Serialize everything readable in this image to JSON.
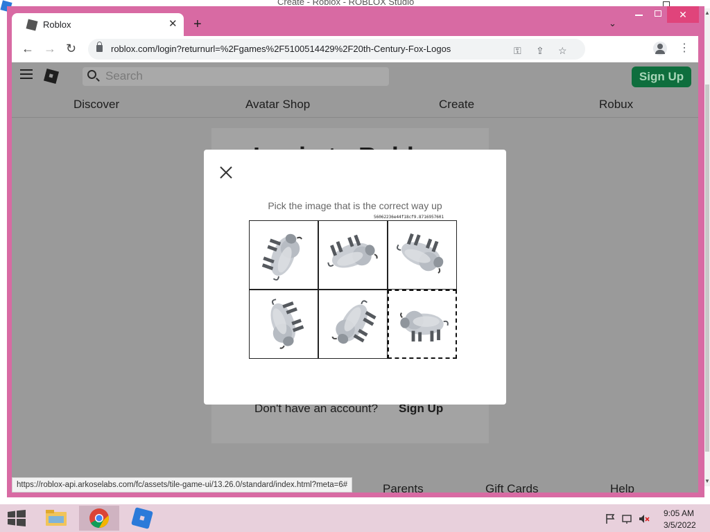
{
  "background_window": {
    "title": "Create - Roblox - ROBLOX Studio"
  },
  "browser": {
    "tab": {
      "title": "Roblox"
    },
    "address_bar": {
      "url": "roblox.com/login?returnurl=%2Fgames%2F5100514429%2F20th-Century-Fox-Logos"
    },
    "status_url": "https://roblox-api.arkoselabs.com/fc/assets/tile-game-ui/13.26.0/standard/index.html?meta=6#"
  },
  "roblox": {
    "search": {
      "placeholder": "Search"
    },
    "signup_button": "Sign Up",
    "nav": [
      "Discover",
      "Avatar Shop",
      "Create",
      "Robux"
    ],
    "login_heading": "Login to Roblox",
    "no_account_text": "Don't have an account?",
    "no_account_signup": "Sign Up",
    "footer_links": [
      "Parents",
      "Gift Cards",
      "Help"
    ]
  },
  "captcha": {
    "prompt": "Pick the image that is the correct way up",
    "session_hash": "56062236e44f18cf9.8716957601",
    "tiles": [
      {
        "rotation": 110,
        "selected": false
      },
      {
        "rotation": 160,
        "selected": false
      },
      {
        "rotation": 200,
        "selected": false
      },
      {
        "rotation": 250,
        "selected": false
      },
      {
        "rotation": 300,
        "selected": false
      },
      {
        "rotation": 0,
        "selected": true
      }
    ]
  },
  "taskbar": {
    "apps": [
      "file-explorer",
      "chrome",
      "roblox-studio"
    ],
    "time": "9:05 AM",
    "date": "3/5/2022"
  },
  "colors": {
    "frame_accent": "#d86aa3",
    "roblox_signup": "#0e6e3d",
    "overlay": "#9a9a9a"
  }
}
